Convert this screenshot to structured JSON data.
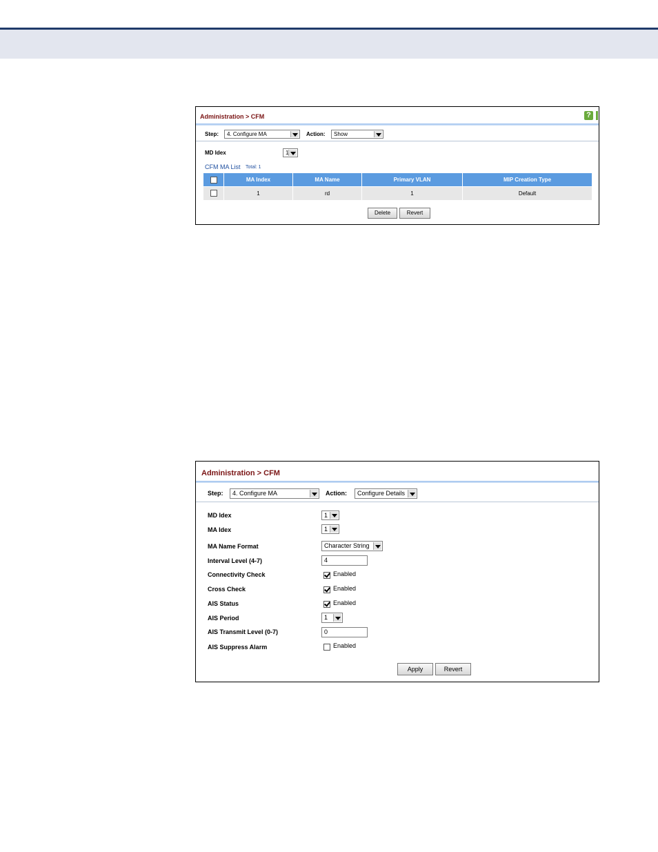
{
  "panel1": {
    "breadcrumb": "Administration > CFM",
    "step_label": "Step:",
    "step_value": "4. Configure MA",
    "action_label": "Action:",
    "action_value": "Show",
    "md_index_label": "MD Idex",
    "md_index_value": "1",
    "list_title": "CFM MA List",
    "list_total": "Total: 1",
    "columns": [
      "MA Index",
      "MA Name",
      "Primary VLAN",
      "MIP Creation Type"
    ],
    "rows": [
      {
        "ma_index": "1",
        "ma_name": "rd",
        "primary_vlan": "1",
        "mip_creation_type": "Default"
      }
    ],
    "delete_label": "Delete",
    "revert_label": "Revert"
  },
  "panel2": {
    "breadcrumb": "Administration > CFM",
    "step_label": "Step:",
    "step_value": "4. Configure MA",
    "action_label": "Action:",
    "action_value": "Configure Details",
    "md_index_label": "MD Idex",
    "md_index_value": "1",
    "ma_index_label": "MA Idex",
    "ma_index_value": "1",
    "ma_name_format_label": "MA Name Format",
    "ma_name_format_value": "Character String",
    "interval_level_label": "Interval Level (4-7)",
    "interval_level_value": "4",
    "connectivity_check_label": "Connectivity Check",
    "connectivity_check_enabled": "Enabled",
    "cross_check_label": "Cross Check",
    "cross_check_enabled": "Enabled",
    "ais_status_label": "AIS Status",
    "ais_status_enabled": "Enabled",
    "ais_period_label": "AIS Period",
    "ais_period_value": "1",
    "ais_transmit_level_label": "AIS Transmit Level (0-7)",
    "ais_transmit_level_value": "0",
    "ais_suppress_alarm_label": "AIS Suppress Alarm",
    "ais_suppress_alarm_enabled": "Enabled",
    "apply_label": "Apply",
    "revert_label": "Revert"
  },
  "icons": {
    "help": "?"
  },
  "colors": {
    "breadcrumb": "#7a1414",
    "table_header": "#5b9be0",
    "list_title": "#2050a0"
  }
}
